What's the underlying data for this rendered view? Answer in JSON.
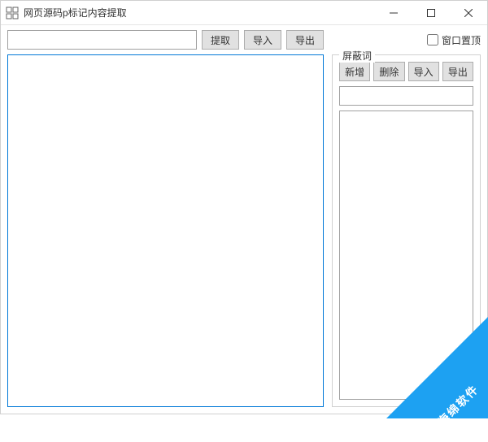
{
  "window": {
    "title": "网页源码p标记内容提取"
  },
  "toolbar": {
    "extract_label": "提取",
    "import_label": "导入",
    "export_label": "导出"
  },
  "path_input": {
    "value": ""
  },
  "main_text": "",
  "pin_checkbox": {
    "label": "窗口置顶",
    "checked": false
  },
  "filter_group": {
    "title": "屏蔽词",
    "add_label": "新增",
    "delete_label": "删除",
    "import_label": "导入",
    "export_label": "导出",
    "input_value": "",
    "items": []
  },
  "watermark": {
    "text": "海绵软件"
  }
}
